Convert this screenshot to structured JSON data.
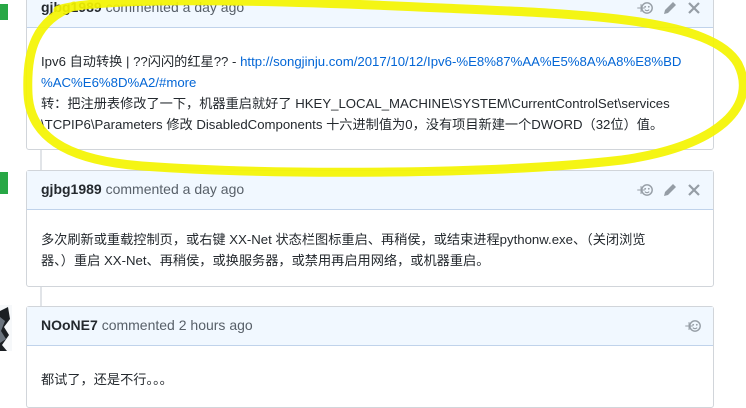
{
  "comments": [
    {
      "author": "gjbg1989",
      "action_text": "commented",
      "time": "a day ago",
      "body": {
        "line1_prefix": "Ipv6 自动转换 | ??闪闪的红星?? - ",
        "line1_link": "http://songjinju.com/2017/10/12/Ipv6-%E8%87%AA%E5%8A%A8%E8%BD",
        "line2_link": "%AC%E6%8D%A2/#more",
        "line3": "转：把注册表修改了一下，机器重启就好了 HKEY_LOCAL_MACHINE\\SYSTEM\\CurrentControlSet\\services",
        "line4": "\\TCPIP6\\Parameters 修改 DisabledComponents 十六进制值为0，没有项目新建一个DWORD（32位）值。"
      }
    },
    {
      "author": "gjbg1989",
      "action_text": "commented",
      "time": "a day ago",
      "body": {
        "line1": "多次刷新或重载控制页，或右键 XX-Net 状态栏图标重启、再稍侯，或结束进程pythonw.exe、（关闭浏览",
        "line2": "器、）重启 XX-Net、再稍侯，或换服务器，或禁用再启用网络，或机器重启。"
      }
    },
    {
      "author": "NOoNE7",
      "action_text": "commented",
      "time": "2 hours ago",
      "body": {
        "line1": "都试了，还是不行。。。"
      }
    }
  ],
  "icons": [
    "add-reaction-icon",
    "pencil-icon",
    "close-icon"
  ],
  "colors": {
    "header_bg": "#f1f8ff",
    "link": "#0366d6",
    "highlight": "#f4f400",
    "status_green": "#28a745"
  }
}
